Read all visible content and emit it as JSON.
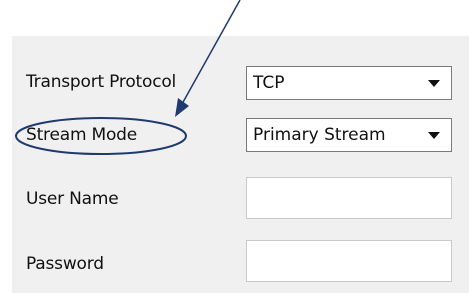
{
  "form": {
    "transport_protocol": {
      "label": "Transport Protocol",
      "value": "TCP"
    },
    "stream_mode": {
      "label": "Stream Mode",
      "value": "Primary Stream"
    },
    "user_name": {
      "label": "User Name",
      "value": ""
    },
    "password": {
      "label": "Password",
      "value": ""
    }
  },
  "annotation": {
    "color": "#1f3a6e",
    "highlighted_field": "stream_mode"
  }
}
